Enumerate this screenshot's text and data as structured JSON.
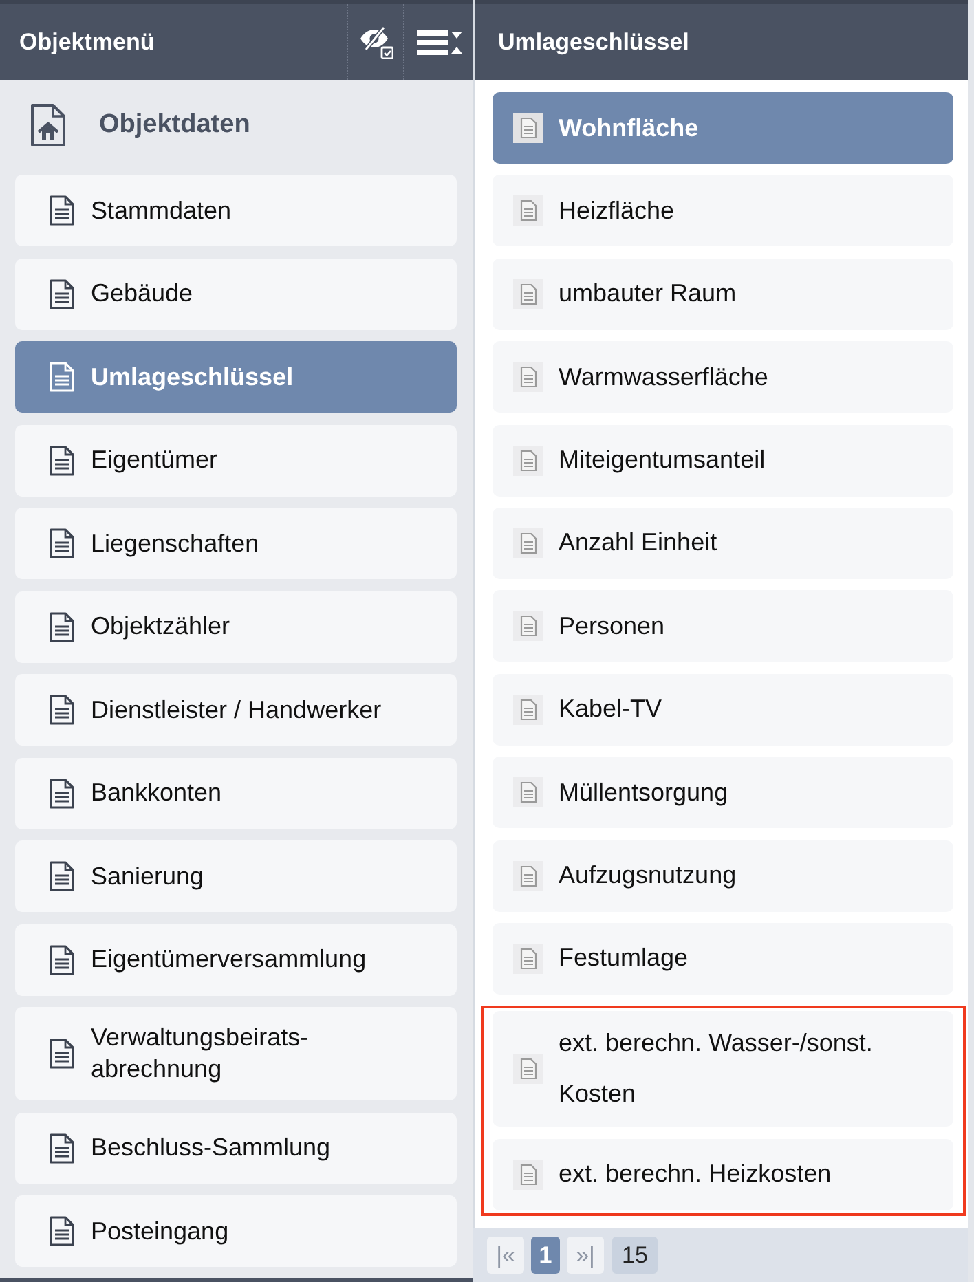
{
  "left_panel": {
    "title": "Objektmenü",
    "section": "Objektdaten",
    "items": [
      {
        "label": "Stammdaten",
        "selected": false
      },
      {
        "label": "Gebäude",
        "selected": false
      },
      {
        "label": "Umlageschlüssel",
        "selected": true
      },
      {
        "label": "Eigentümer",
        "selected": false
      },
      {
        "label": "Liegenschaften",
        "selected": false
      },
      {
        "label": "Objektzähler",
        "selected": false
      },
      {
        "label": "Dienstleister / Handwerker",
        "selected": false
      },
      {
        "label": "Bankkonten",
        "selected": false
      },
      {
        "label": "Sanierung",
        "selected": false
      },
      {
        "label": "Eigentümerversammlung",
        "selected": false
      },
      {
        "label": "Verwaltungsbeirats-abrechnung",
        "selected": false
      },
      {
        "label": "Beschluss-Sammlung",
        "selected": false
      },
      {
        "label": "Posteingang",
        "selected": false
      }
    ]
  },
  "right_panel": {
    "title": "Umlageschlüssel",
    "items": [
      {
        "label": "Wohnfläche",
        "selected": true,
        "highlighted": false
      },
      {
        "label": "Heizfläche",
        "selected": false,
        "highlighted": false
      },
      {
        "label": "umbauter Raum",
        "selected": false,
        "highlighted": false
      },
      {
        "label": "Warmwasserfläche",
        "selected": false,
        "highlighted": false
      },
      {
        "label": "Miteigentumsanteil",
        "selected": false,
        "highlighted": false
      },
      {
        "label": "Anzahl Einheit",
        "selected": false,
        "highlighted": false
      },
      {
        "label": "Personen",
        "selected": false,
        "highlighted": false
      },
      {
        "label": "Kabel-TV",
        "selected": false,
        "highlighted": false
      },
      {
        "label": "Müllentsorgung",
        "selected": false,
        "highlighted": false
      },
      {
        "label": "Aufzugsnutzung",
        "selected": false,
        "highlighted": false
      },
      {
        "label": "Festumlage",
        "selected": false,
        "highlighted": false
      },
      {
        "label": "ext. berechn. Wasser-/sonst. Kosten",
        "selected": false,
        "highlighted": true
      },
      {
        "label": "ext. berechn. Heizkosten",
        "selected": false,
        "highlighted": true
      }
    ],
    "pagination": {
      "first": {
        "label": "|«",
        "disabled": true
      },
      "pages": [
        {
          "label": "1",
          "selected": true
        }
      ],
      "last": {
        "label": "»|",
        "disabled": true
      },
      "count": "15"
    }
  }
}
